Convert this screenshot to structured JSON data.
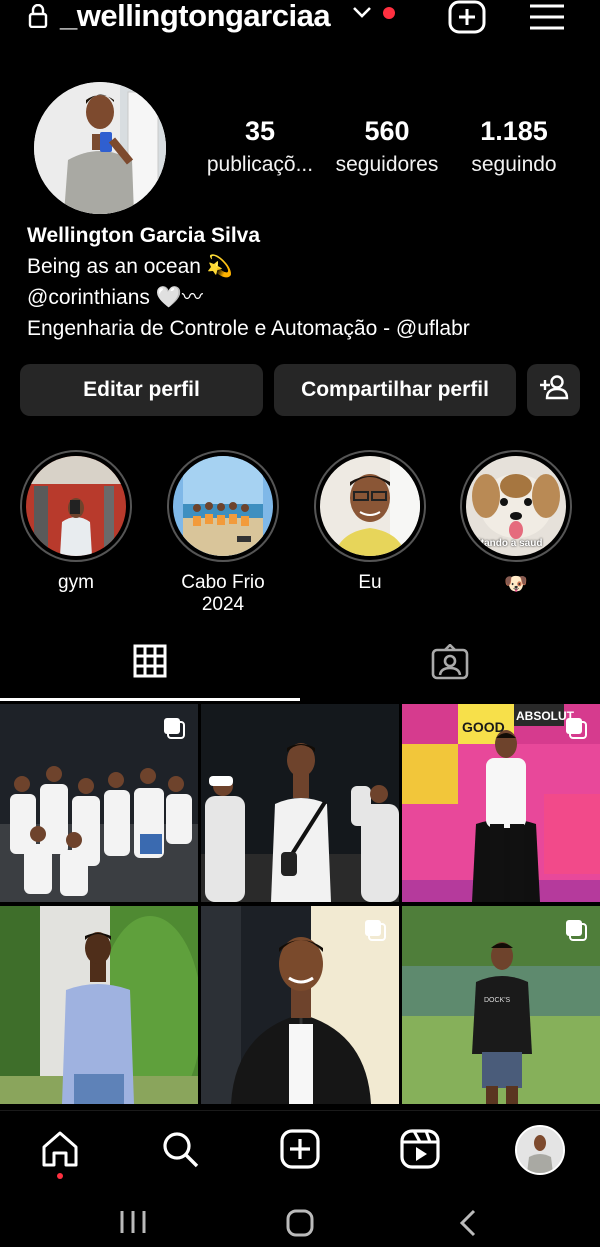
{
  "header": {
    "username": "_wellingtongarciaa"
  },
  "stats": [
    {
      "value": "35",
      "label": "publicaçõ..."
    },
    {
      "value": "560",
      "label": "seguidores"
    },
    {
      "value": "1.185",
      "label": "seguindo"
    }
  ],
  "bio": {
    "name": "Wellington Garcia Silva",
    "line1": "Being as an ocean 💫",
    "line2": "@corinthians 🤍〰",
    "line3": "Engenharia de Controle e Automação - @uflabr"
  },
  "buttons": {
    "edit": "Editar perfil",
    "share": "Compartilhar perfil"
  },
  "highlights": [
    {
      "label": "gym"
    },
    {
      "label": "Cabo Frio 2024"
    },
    {
      "label": "Eu"
    },
    {
      "label": "🐶",
      "overlay": "itando a saud"
    }
  ],
  "posts": [
    {
      "overlay": "",
      "multi": true
    },
    {
      "overlay": "",
      "multi": false
    },
    {
      "overlay": "GOOD VIBES ONLY · ABSOLUT.",
      "multi": true
    },
    {
      "overlay": "",
      "multi": false
    },
    {
      "overlay": "",
      "multi": true
    },
    {
      "overlay": "DOCK'S BURGER",
      "multi": true
    }
  ],
  "icons": {
    "header": [
      "lock-icon",
      "chevron-down-icon",
      "add-icon",
      "menu-icon"
    ],
    "tabs": [
      "grid-icon",
      "tagged-icon"
    ],
    "nav": [
      "home-icon",
      "search-icon",
      "create-icon",
      "reels-icon",
      "profile-avatar"
    ],
    "system": [
      "recent-apps-icon",
      "home-button-icon",
      "back-icon"
    ]
  },
  "colors": {
    "background": "#000000",
    "button": "#262626",
    "notification": "#ff3040"
  }
}
